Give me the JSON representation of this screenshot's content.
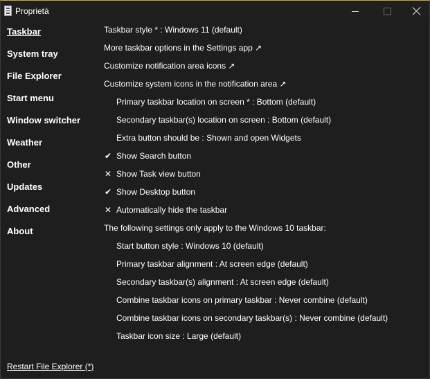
{
  "window": {
    "title": "Proprietà"
  },
  "sidebar": {
    "items": [
      {
        "label": "Taskbar"
      },
      {
        "label": "System tray"
      },
      {
        "label": "File Explorer"
      },
      {
        "label": "Start menu"
      },
      {
        "label": "Window switcher"
      },
      {
        "label": "Weather"
      },
      {
        "label": "Other"
      },
      {
        "label": "Updates"
      },
      {
        "label": "Advanced"
      },
      {
        "label": "About"
      }
    ],
    "active_item": "Taskbar"
  },
  "settings": {
    "taskbar_style": "Taskbar style * : Windows 11 (default)",
    "more_options": "More taskbar options in the Settings app ↗",
    "notif_icons": "Customize notification area icons ↗",
    "system_icons": "Customize system icons in the notification area ↗",
    "primary_location": "Primary taskbar location on screen * : Bottom (default)",
    "secondary_location": "Secondary taskbar(s) location on screen : Bottom (default)",
    "extra_button": "Extra button should be : Shown and open Widgets",
    "show_search": {
      "label": "Show Search button",
      "mark": "✔",
      "checked": true
    },
    "show_task_view": {
      "label": "Show Task view button",
      "mark": "✕",
      "checked": false
    },
    "show_desktop": {
      "label": "Show Desktop button",
      "mark": "✔",
      "checked": true
    },
    "auto_hide": {
      "label": "Automatically hide the taskbar",
      "mark": "✕",
      "checked": false
    },
    "win10_heading": "The following settings only apply to the Windows 10 taskbar:",
    "start_button_style": "Start button style : Windows 10 (default)",
    "primary_alignment": "Primary taskbar alignment : At screen edge (default)",
    "secondary_alignment": "Secondary taskbar(s) alignment : At screen edge (default)",
    "combine_primary": "Combine taskbar icons on primary taskbar : Never combine (default)",
    "combine_secondary": "Combine taskbar icons on secondary taskbar(s) : Never combine (default)",
    "icon_size": "Taskbar icon size : Large (default)"
  },
  "footer": {
    "restart_label": "Restart File Explorer (*)"
  },
  "colors": {
    "background": "#1e1e1e",
    "text": "#ffffff",
    "title_accent": "#d4a92a"
  }
}
